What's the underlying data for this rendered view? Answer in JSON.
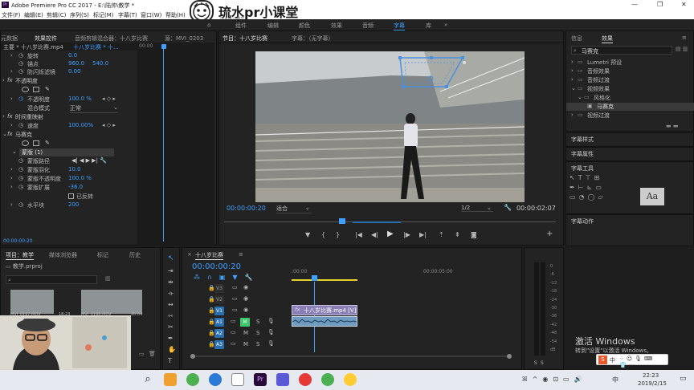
{
  "app": {
    "title": "Adobe Premiere Pro CC 2017 - E:\\陆帅\\教学 *",
    "pr_icon_text": "Pr"
  },
  "menu": [
    "文件(F)",
    "编辑(E)",
    "剪辑(C)",
    "序列(S)",
    "标记(M)",
    "字幕(T)",
    "窗口(W)",
    "帮助(H)"
  ],
  "watermark": {
    "text": "琉水pr小课堂",
    "sub": "琉水pr小课堂"
  },
  "workspaces": [
    "组件",
    "编辑",
    "颜色",
    "效果",
    "音频",
    "字幕",
    "库"
  ],
  "workspace_active": "字幕",
  "effect_controls": {
    "tabs": [
      "元数据",
      "效果控件",
      "音频剪辑混合器：十八岁比赛",
      "源：MVI_0203"
    ],
    "clip_path": "主要 * 十八岁比赛.mp4",
    "seq_path": "十八岁比赛 * 十...",
    "ruler_time": "00:00",
    "rows": {
      "rotate_label": "旋转",
      "rotate_value": "0.0",
      "anchor_label": "锚点",
      "anchor_x": "960.0",
      "anchor_y": "540.0",
      "flicker_label": "防闪烁滤镜",
      "flicker_value": "0.00",
      "opacity_section": "不透明度",
      "opacity_label": "不透明度",
      "opacity_value": "100.0 %",
      "blend_label": "混合模式",
      "blend_value": "正常",
      "timeremap_section": "时间重映射",
      "speed_label": "速度",
      "speed_value": "100.00%",
      "mosaic_section": "马赛克",
      "mask_label": "蒙版 (1)",
      "mask_path_label": "蒙版路径",
      "mask_feather_label": "蒙版羽化",
      "mask_feather_value": "10.0",
      "mask_opacity_label": "蒙版不透明度",
      "mask_opacity_value": "100.0 %",
      "mask_expand_label": "蒙版扩展",
      "mask_expand_value": "-36.0",
      "inverted_label": "已反转",
      "hblocks_label": "水平块",
      "hblocks_value": "200"
    },
    "footer_time": "00:00:00:20"
  },
  "program_monitor": {
    "tabs": [
      "节目：十八岁比赛",
      "字幕：（无字幕）"
    ],
    "timecode": "00:00:00:20",
    "fit": "适合",
    "scale": "1/2",
    "duration": "00:00:02:07"
  },
  "effects_panel": {
    "tabs": [
      "信息",
      "效果"
    ],
    "search_value": "马赛克",
    "tree": [
      {
        "label": "Lumetri 预设",
        "indent": 0
      },
      {
        "label": "音频效果",
        "indent": 0
      },
      {
        "label": "音频过渡",
        "indent": 0
      },
      {
        "label": "视频效果",
        "indent": 0
      },
      {
        "label": "风格化",
        "indent": 1
      },
      {
        "label": "马赛克",
        "indent": 2
      },
      {
        "label": "视频过渡",
        "indent": 0
      }
    ],
    "sections": [
      "字幕样式",
      "字幕属性",
      "字幕工具",
      "字幕动作"
    ]
  },
  "project_panel": {
    "tabs": [
      "项目：教学",
      "媒体浏览器",
      "标记",
      "历史"
    ],
    "project_file": "教学.prproj",
    "clips": [
      {
        "name": "MVI_0197.MOV",
        "duration": "18:23"
      },
      {
        "name": "MVI_0198.MOV",
        "duration": "20:04"
      }
    ]
  },
  "timeline": {
    "tab": "十八岁比赛",
    "timecode": "00:00:00:20",
    "ruler_start": ":00:00",
    "ruler_mark": "00:00:05:00",
    "tracks": [
      {
        "name": "V3",
        "kind": "video"
      },
      {
        "name": "V2",
        "kind": "video"
      },
      {
        "name": "V1",
        "kind": "video"
      },
      {
        "name": "A1",
        "kind": "audio"
      },
      {
        "name": "A2",
        "kind": "audio"
      },
      {
        "name": "A3",
        "kind": "audio"
      }
    ],
    "clip_v1": "十八岁比赛.mp4 [V]",
    "mute_label": "M",
    "solo_label": "S"
  },
  "audio_meter": {
    "scale": [
      "0",
      "-6",
      "-12",
      "-18",
      "-24",
      "-30",
      "-36",
      "-42",
      "-48",
      "-54",
      "dB"
    ],
    "solo_labels": [
      "S",
      "S"
    ]
  },
  "windows_activation": {
    "line1": "激活 Windows",
    "line2": "转到\"设置\"以激活 Windows。"
  },
  "taskbar": {
    "ime": "中",
    "time": "22:23",
    "date": "2019/2/15"
  },
  "colors": {
    "accent": "#3fa0ff",
    "mask_blue": "#4a90e0",
    "track_active": "#2a6fb0",
    "mute_green": "#3bcb6e",
    "clip_purple": "#8a7fb5",
    "audio_clip": "#6f9bc0"
  }
}
